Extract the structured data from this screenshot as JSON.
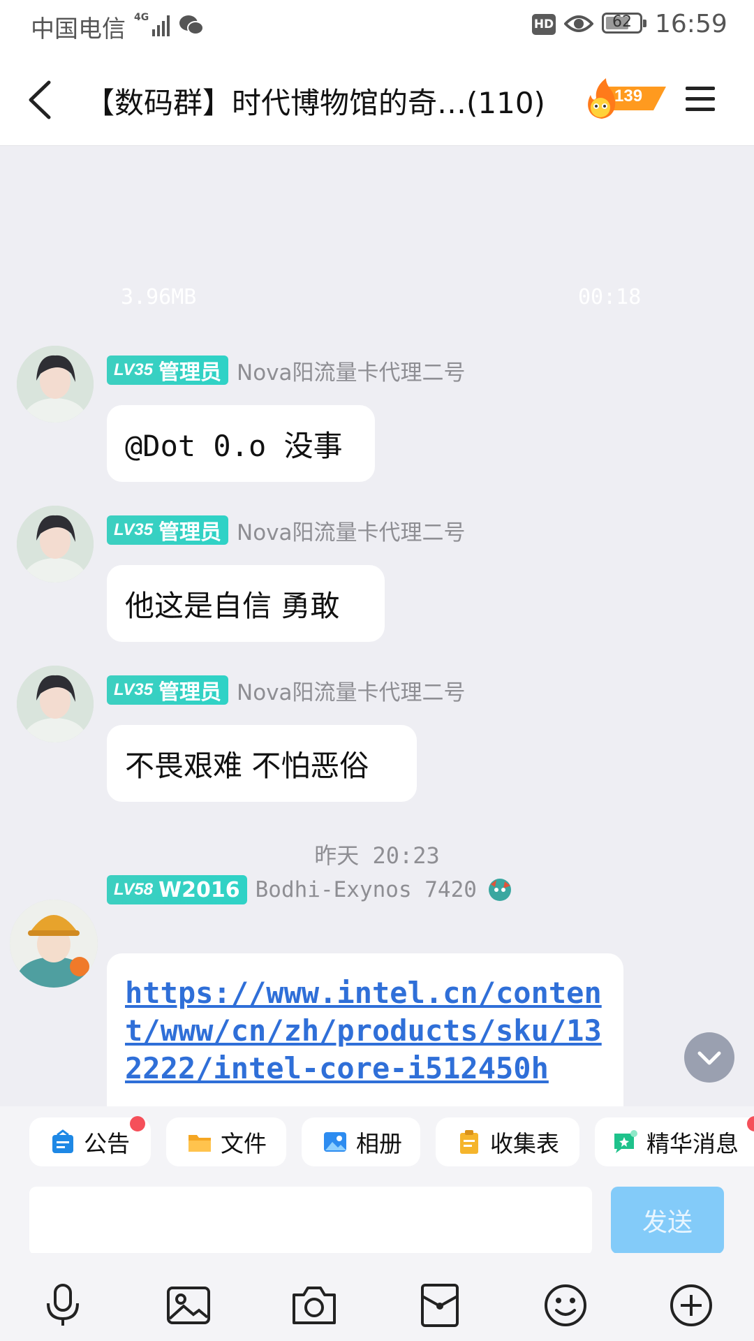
{
  "status_bar": {
    "carrier": "中国电信",
    "network": "4G",
    "hd": "HD",
    "battery": "62",
    "time": "16:59"
  },
  "header": {
    "title": "【数码群】时代博物馆的奇…(110)",
    "fire_count": "139"
  },
  "media": {
    "size": "3.96MB",
    "duration": "00:18"
  },
  "messages": [
    {
      "level": "LV35",
      "role": "管理员",
      "sender": "Nova阳流量卡代理二号",
      "text": "@Dot 0.o 没事"
    },
    {
      "level": "LV35",
      "role": "管理员",
      "sender": "Nova阳流量卡代理二号",
      "text": "他这是自信  勇敢"
    },
    {
      "level": "LV35",
      "role": "管理员",
      "sender": "Nova阳流量卡代理二号",
      "text": "不畏艰难  不怕恶俗"
    }
  ],
  "timestamp": "昨天 20:23",
  "link_message": {
    "level": "LV58",
    "role": "W2016",
    "sender": "Bodhi-Exynos 7420",
    "link": "https://www.intel.cn/content/www/cn/zh/products/sku/132222/intel-core-i512450h"
  },
  "quick_actions": [
    {
      "label": "公告"
    },
    {
      "label": "文件"
    },
    {
      "label": "相册"
    },
    {
      "label": "收集表"
    },
    {
      "label": "精华消息"
    }
  ],
  "composer": {
    "placeholder": "",
    "send_label": "发送"
  },
  "colors": {
    "badge": "#2fd2c6",
    "link": "#2f6fd8",
    "send_disabled": "#83cbf9",
    "notify_dot": "#f5505a"
  }
}
